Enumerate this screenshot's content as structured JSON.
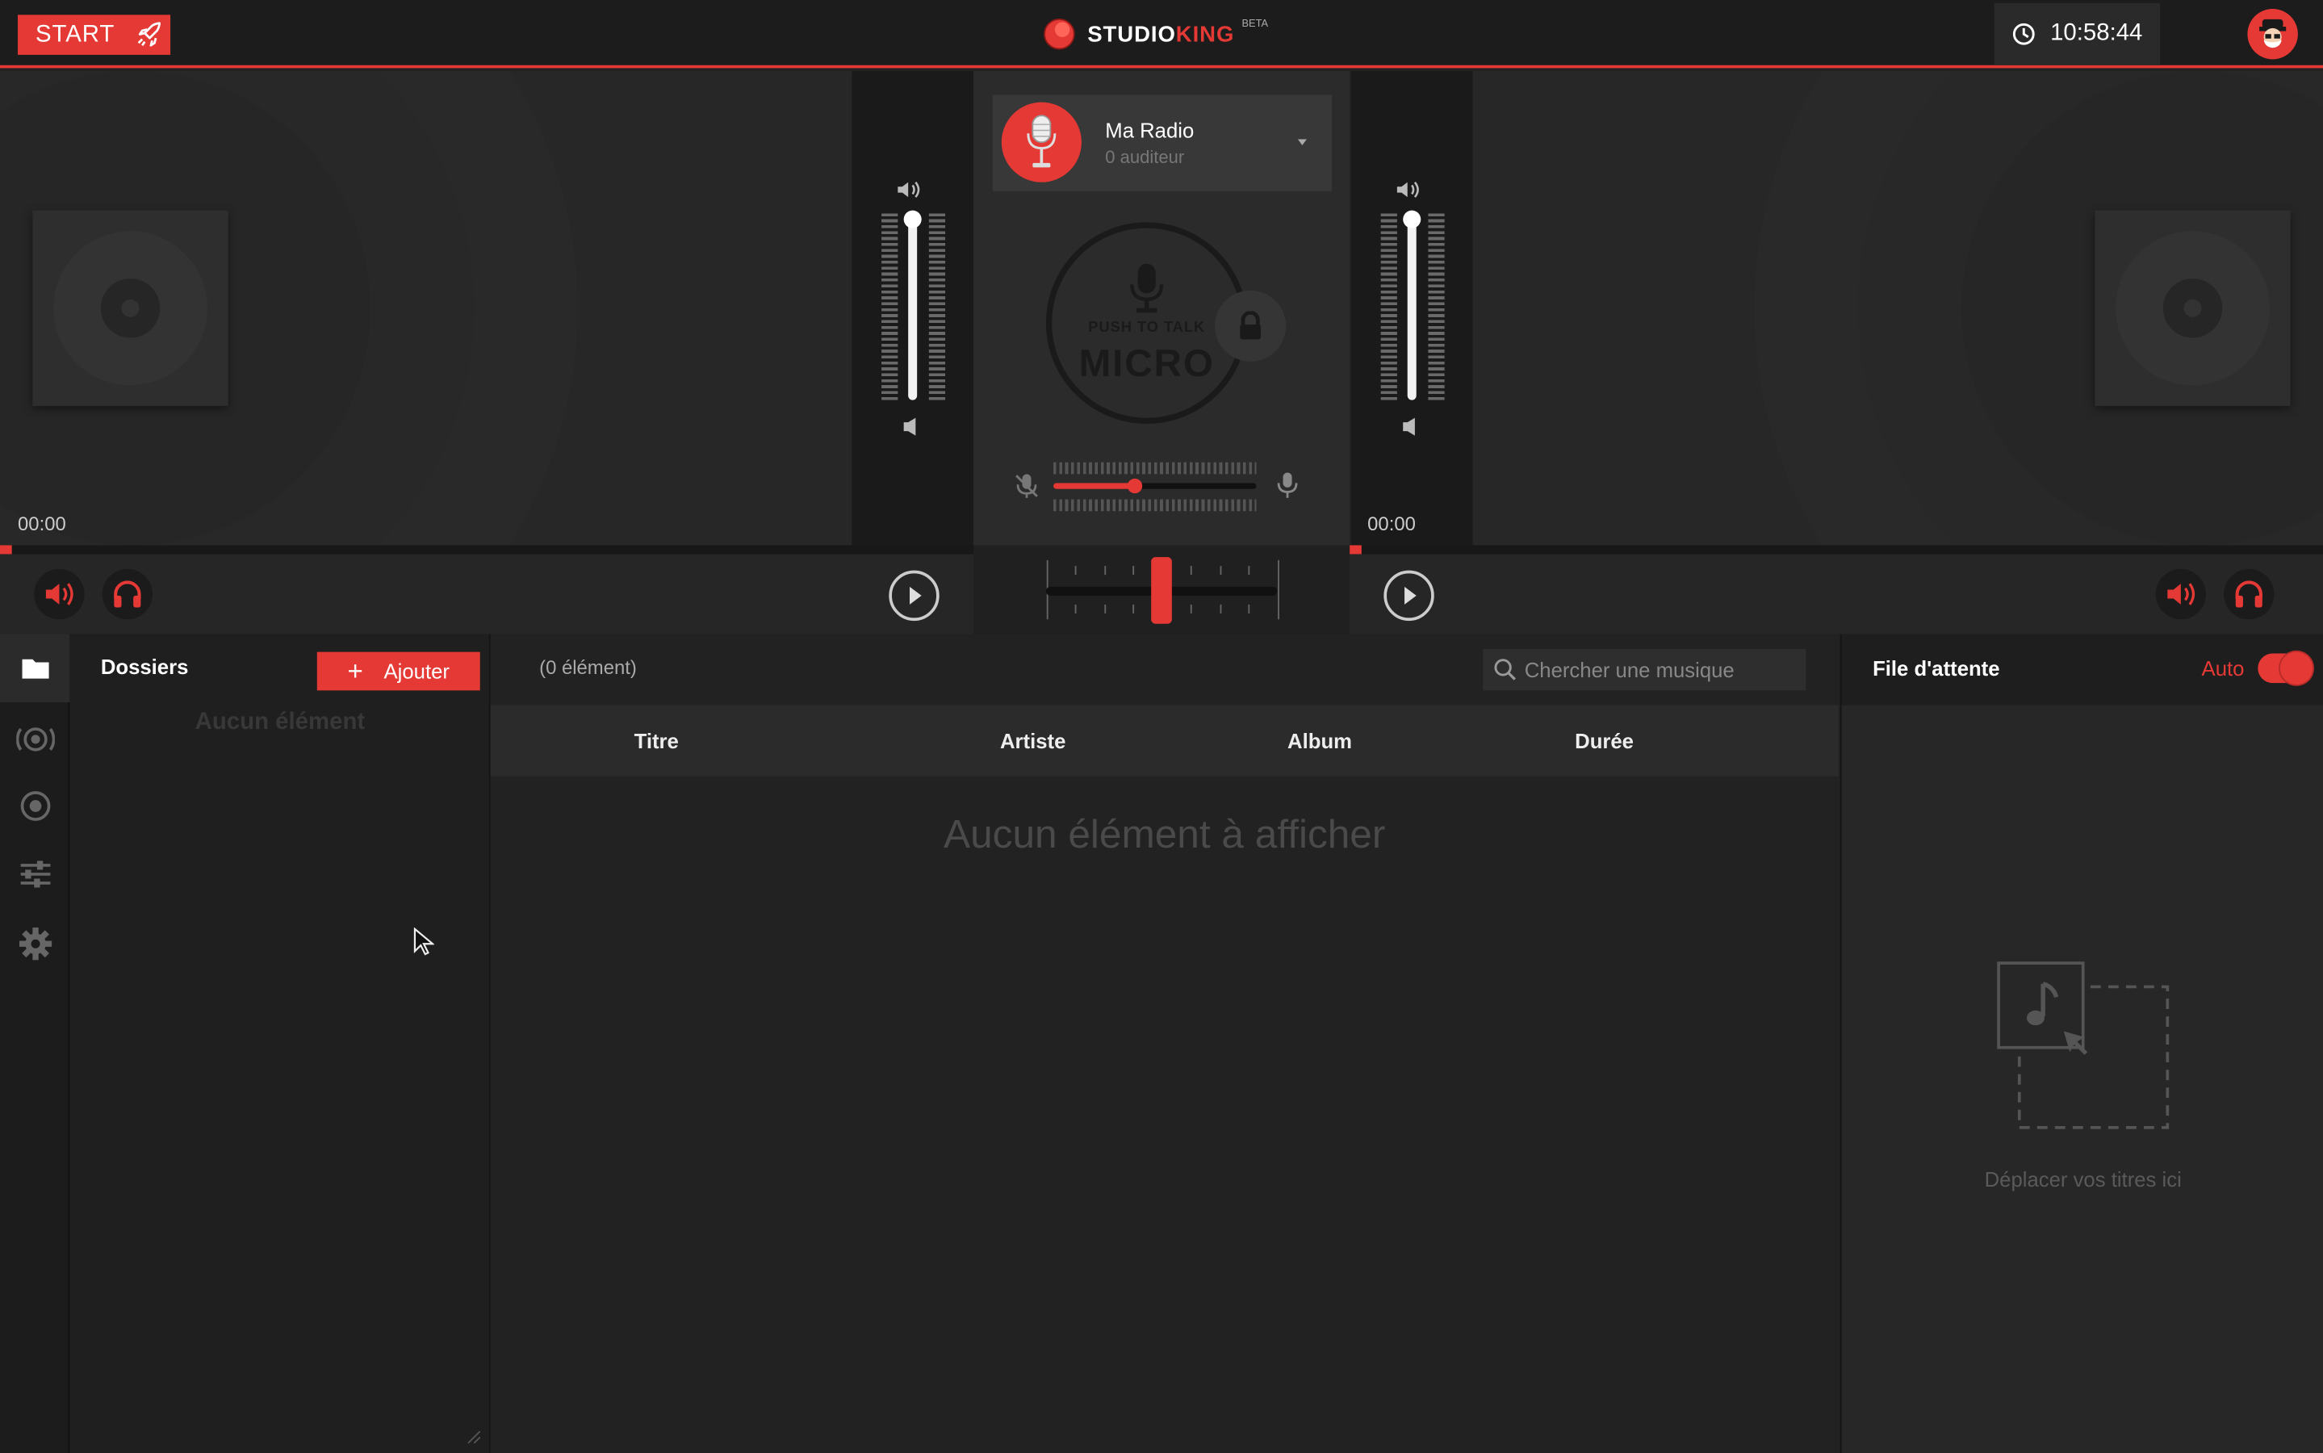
{
  "topbar": {
    "start_label": "START",
    "logo_part1": "STUDIO",
    "logo_part2": "KING",
    "logo_badge": "BETA",
    "clock": "10:58:44"
  },
  "decks": {
    "left": {
      "time": "00:00",
      "progress": 0
    },
    "right": {
      "time": "00:00",
      "progress": 0
    }
  },
  "volumes": {
    "left": 1.0,
    "right": 1.0
  },
  "radio": {
    "name": "Ma Radio",
    "listeners": "0 auditeur"
  },
  "micro": {
    "push_to_talk": "PUSH TO TALK",
    "label": "MICRO",
    "mic_level": 0.4
  },
  "crossfader": {
    "position": 0.5
  },
  "folders": {
    "title": "Dossiers",
    "add_label": "Ajouter",
    "empty": "Aucun élément"
  },
  "library": {
    "count": "(0 élément)",
    "search_placeholder": "Chercher une musique",
    "columns": [
      "Titre",
      "Artiste",
      "Album",
      "Durée"
    ],
    "empty": "Aucun élément à afficher"
  },
  "queue": {
    "title": "File d'attente",
    "auto_label": "Auto",
    "auto_on": true,
    "empty": "Déplacer vos titres ici"
  },
  "colors": {
    "accent": "#e53935",
    "background": "#222222",
    "bar": "#1c1c1c"
  }
}
